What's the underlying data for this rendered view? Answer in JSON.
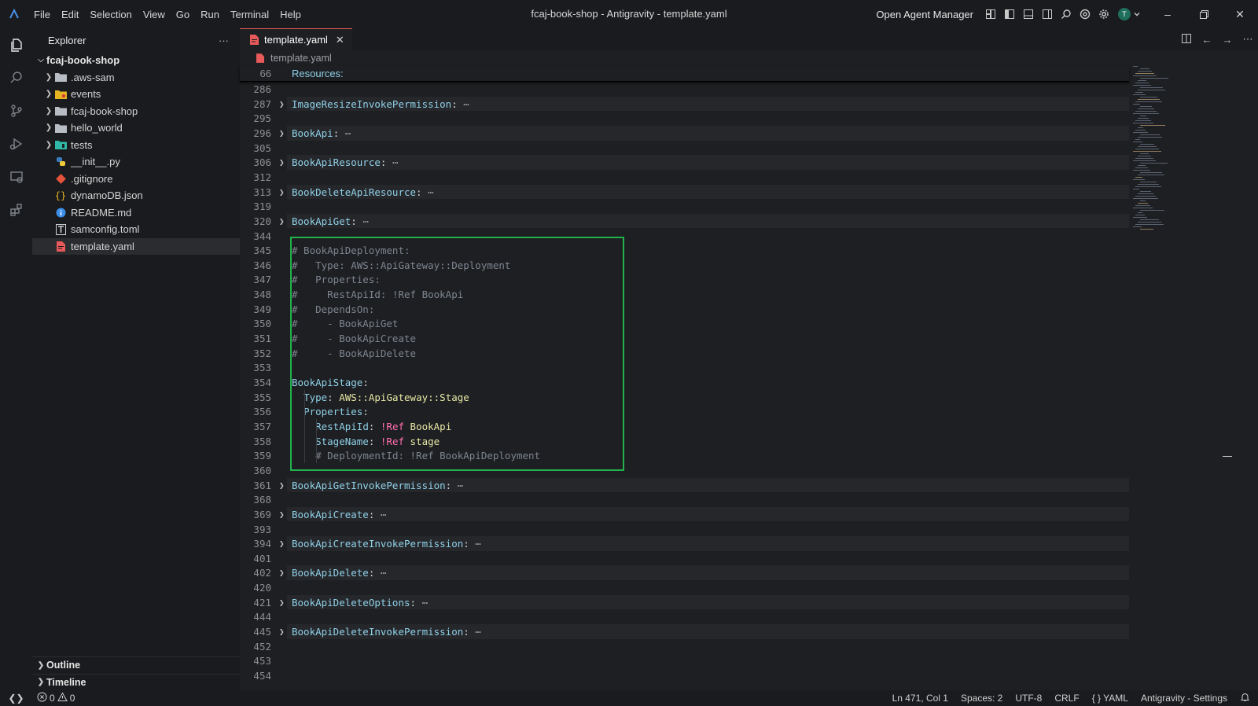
{
  "window": {
    "title": "fcaj-book-shop - Antigravity - template.yaml",
    "menu": [
      "File",
      "Edit",
      "Selection",
      "View",
      "Go",
      "Run",
      "Terminal",
      "Help"
    ],
    "agent_manager_label": "Open Agent Manager",
    "avatar_letter": "T"
  },
  "sidebar": {
    "title": "Explorer",
    "more_label": "···",
    "root": "fcaj-book-shop",
    "items": [
      {
        "label": ".aws-sam",
        "kind": "folder"
      },
      {
        "label": "events",
        "kind": "folder-events"
      },
      {
        "label": "fcaj-book-shop",
        "kind": "folder"
      },
      {
        "label": "hello_world",
        "kind": "folder"
      },
      {
        "label": "tests",
        "kind": "folder-tests"
      },
      {
        "label": "__init__.py",
        "kind": "python"
      },
      {
        "label": ".gitignore",
        "kind": "git"
      },
      {
        "label": "dynamoDB.json",
        "kind": "json"
      },
      {
        "label": "README.md",
        "kind": "info"
      },
      {
        "label": "samconfig.toml",
        "kind": "toml"
      },
      {
        "label": "template.yaml",
        "kind": "yaml"
      }
    ],
    "outline_label": "Outline",
    "timeline_label": "Timeline"
  },
  "editor": {
    "tab_label": "template.yaml",
    "breadcrumb": "template.yaml",
    "sticky": {
      "line": "66",
      "text": "Resources:"
    },
    "lines": [
      {
        "n": "286",
        "text": ""
      },
      {
        "n": "287",
        "key": "ImageResizeInvokePermission",
        "folded": true
      },
      {
        "n": "295",
        "text": ""
      },
      {
        "n": "296",
        "key": "BookApi",
        "folded": true
      },
      {
        "n": "305",
        "text": ""
      },
      {
        "n": "306",
        "key": "BookApiResource",
        "folded": true
      },
      {
        "n": "312",
        "text": ""
      },
      {
        "n": "313",
        "key": "BookDeleteApiResource",
        "folded": true
      },
      {
        "n": "319",
        "text": ""
      },
      {
        "n": "320",
        "key": "BookApiGet",
        "folded": true
      },
      {
        "n": "344",
        "text": ""
      },
      {
        "n": "345",
        "comment": "# BookApiDeployment:"
      },
      {
        "n": "346",
        "comment": "#   Type: AWS::ApiGateway::Deployment"
      },
      {
        "n": "347",
        "comment": "#   Properties:"
      },
      {
        "n": "348",
        "comment": "#     RestApiId: !Ref BookApi"
      },
      {
        "n": "349",
        "comment": "#   DependsOn:"
      },
      {
        "n": "350",
        "comment": "#     - BookApiGet"
      },
      {
        "n": "351",
        "comment": "#     - BookApiCreate"
      },
      {
        "n": "352",
        "comment": "#     - BookApiDelete"
      },
      {
        "n": "353",
        "text": ""
      },
      {
        "n": "354",
        "key": "BookApiStage"
      },
      {
        "n": "355",
        "indent": "  ",
        "key": "Type",
        "value": "AWS::ApiGateway::Stage"
      },
      {
        "n": "356",
        "indent": "  ",
        "key": "Properties"
      },
      {
        "n": "357",
        "indent": "    ",
        "key": "RestApiId",
        "tag": "!Ref",
        "value": "BookApi"
      },
      {
        "n": "358",
        "indent": "    ",
        "key": "StageName",
        "tag": "!Ref",
        "value": "stage"
      },
      {
        "n": "359",
        "indent": "    ",
        "comment": "# DeploymentId: !Ref BookApiDeployment"
      },
      {
        "n": "360",
        "text": ""
      },
      {
        "n": "361",
        "key": "BookApiGetInvokePermission",
        "folded": true
      },
      {
        "n": "368",
        "text": ""
      },
      {
        "n": "369",
        "key": "BookApiCreate",
        "folded": true
      },
      {
        "n": "393",
        "text": ""
      },
      {
        "n": "394",
        "key": "BookApiCreateInvokePermission",
        "folded": true
      },
      {
        "n": "401",
        "text": ""
      },
      {
        "n": "402",
        "key": "BookApiDelete",
        "folded": true
      },
      {
        "n": "420",
        "text": ""
      },
      {
        "n": "421",
        "key": "BookApiDeleteOptions",
        "folded": true
      },
      {
        "n": "444",
        "text": ""
      },
      {
        "n": "445",
        "key": "BookApiDeleteInvokePermission",
        "folded": true
      },
      {
        "n": "452",
        "text": ""
      },
      {
        "n": "453",
        "text": ""
      },
      {
        "n": "454",
        "text": ""
      }
    ]
  },
  "statusbar": {
    "errors": "0",
    "warnings": "0",
    "position": "Ln 471, Col 1",
    "spaces": "Spaces: 2",
    "encoding": "UTF-8",
    "eol": "CRLF",
    "language": "{ } YAML",
    "settings": "Antigravity - Settings"
  },
  "colors": {
    "highlight_box": "#22b14c",
    "accent_tab": "#e8595a",
    "key": "#8fd1e8",
    "comment": "#7d8590",
    "string": "#e8e8a6",
    "tag": "#ff6fb0"
  }
}
